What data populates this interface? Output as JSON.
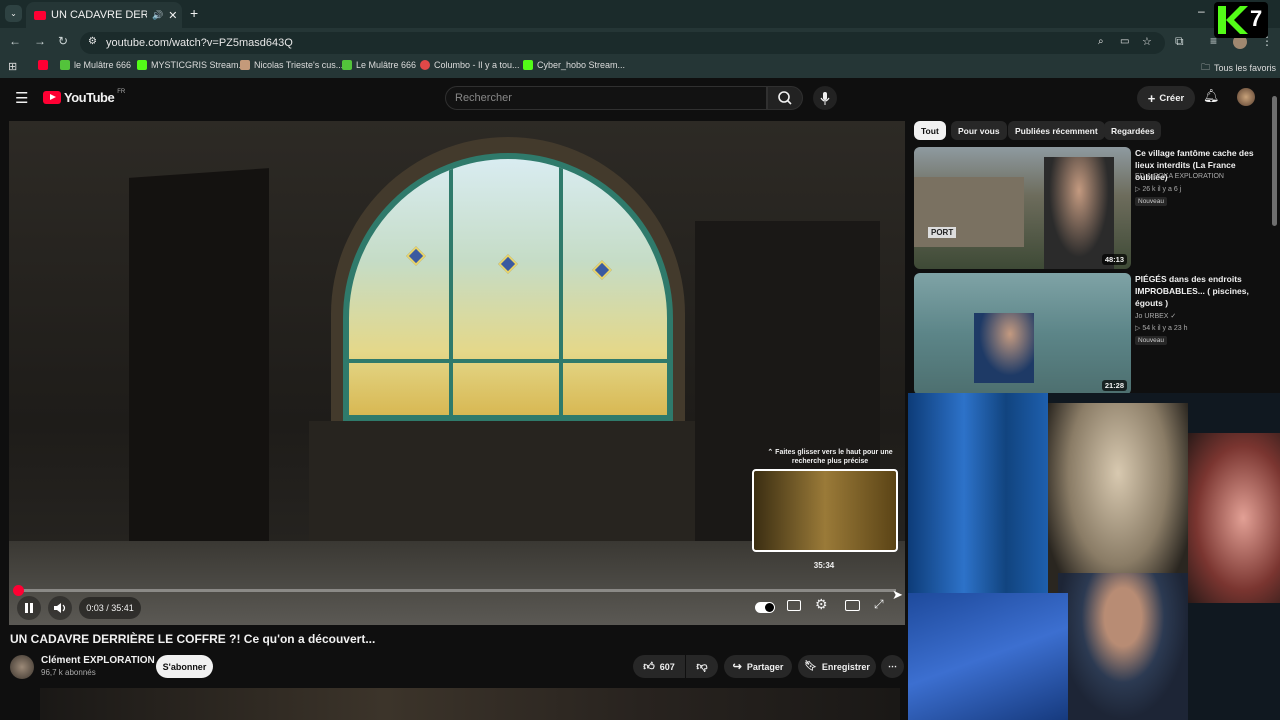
{
  "browser": {
    "tab_title": "UN CADAVRE DERRIÈRE LE",
    "url": "youtube.com/watch?v=PZ5masd643Q",
    "bookmarks": [
      "le Mulâtre 666",
      "MYSTICGRIS Stream...",
      "Nicolas Trieste's cus...",
      "Le Mulâtre 666",
      "Columbo - Il y a tou...",
      "Cyber_hobo Stream..."
    ],
    "all_bookmarks": "Tous les favoris"
  },
  "youtube": {
    "logo": "YouTube",
    "logo_region": "FR",
    "search_placeholder": "Rechercher",
    "create_label": "Créer"
  },
  "player": {
    "time_display": "0:03 / 35:41",
    "progress_fraction": 0.0014,
    "hint_text": "Faites glisser vers le haut pour une recherche plus précise",
    "preview_time": "35:34"
  },
  "video": {
    "title": "UN CADAVRE DERRIÈRE LE COFFRE ?! Ce qu'on a découvert...",
    "channel": "Clément EXPLORATION",
    "subscribers": "96,7 k abonnés",
    "subscribe_label": "S'abonner",
    "likes": "607",
    "share_label": "Partager",
    "save_label": "Enregistrer"
  },
  "chips": [
    "Tout",
    "Pour vous",
    "Publiées récemment",
    "Regardées"
  ],
  "recommendations": [
    {
      "title": "Ce village fantôme cache des lieux interdits (La France oubliée)",
      "channel": "ED & ROKA EXPLORATION",
      "meta": "▷ 26 k  il y a 6 j",
      "badge": "Nouveau",
      "duration": "48:13",
      "thumb_sign": "PORT"
    },
    {
      "title": "PIÉGÉS dans des endroits IMPROBABLES... ( piscines, égouts )",
      "channel": "Jo URBEX",
      "meta": "▷ 54 k  il y a 23 h",
      "badge": "Nouveau",
      "duration": "21:28"
    }
  ],
  "overlay": {
    "k7_logo_text": "7"
  },
  "colors": {
    "youtube_red": "#ff0033",
    "browser_bg": "#253636",
    "page_bg": "#0f0f0f"
  }
}
